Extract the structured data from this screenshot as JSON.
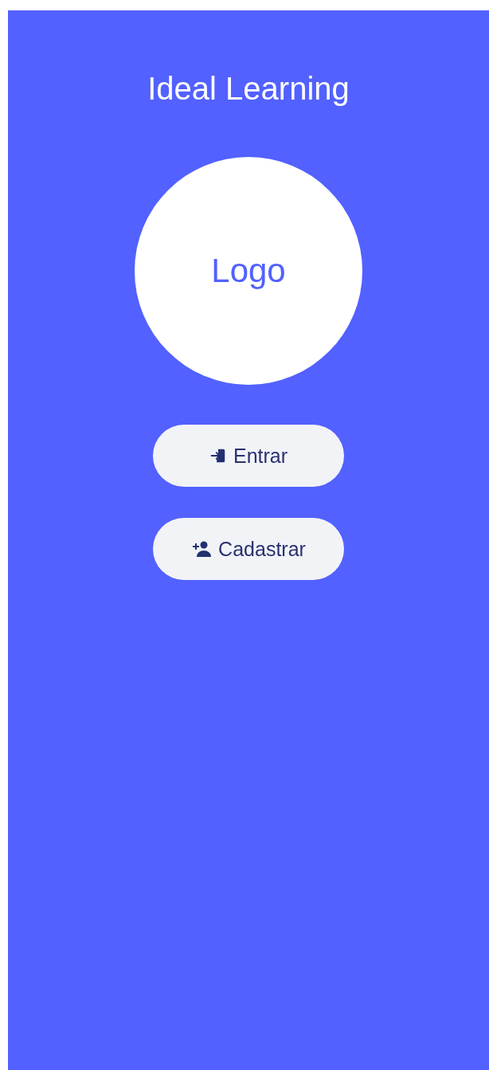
{
  "title": "Ideal Learning",
  "logo": {
    "label": "Logo"
  },
  "buttons": [
    {
      "kind": "login",
      "label": "Entrar"
    },
    {
      "kind": "signup",
      "label": "Cadastrar"
    }
  ]
}
